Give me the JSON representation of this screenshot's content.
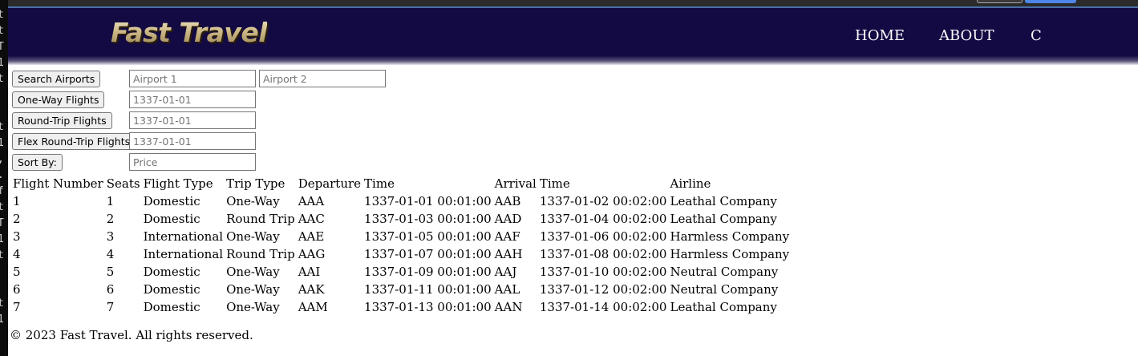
{
  "header": {
    "logo_text": "Fast Travel",
    "nav": [
      "HOME",
      "ABOUT",
      "C"
    ]
  },
  "controls": {
    "search_airports_label": "Search Airports",
    "airport1_placeholder": "Airport 1",
    "airport2_placeholder": "Airport 2",
    "one_way_label": "One-Way Flights",
    "one_way_placeholder": "1337-01-01",
    "round_trip_label": "Round-Trip Flights",
    "round_trip_placeholder": "1337-01-01",
    "flex_round_trip_label": "Flex Round-Trip Flights",
    "flex_round_trip_placeholder": "1337-01-01",
    "sort_by_label": "Sort By:",
    "sort_by_placeholder": "Price"
  },
  "table": {
    "headers": [
      "Flight Number",
      "Seats",
      "Flight Type",
      "Trip Type",
      "Departure",
      "Time",
      "Arrival",
      "Time",
      "Airline"
    ],
    "rows": [
      [
        "1",
        "1",
        "Domestic",
        "One-Way",
        "AAA",
        "1337-01-01 00:01:00",
        "AAB",
        "1337-01-02 00:02:00",
        "Leathal Company"
      ],
      [
        "2",
        "2",
        "Domestic",
        "Round Trip",
        "AAC",
        "1337-01-03 00:01:00",
        "AAD",
        "1337-01-04 00:02:00",
        "Leathal Company"
      ],
      [
        "3",
        "3",
        "International",
        "One-Way",
        "AAE",
        "1337-01-05 00:01:00",
        "AAF",
        "1337-01-06 00:02:00",
        "Harmless Company"
      ],
      [
        "4",
        "4",
        "International",
        "Round Trip",
        "AAG",
        "1337-01-07 00:01:00",
        "AAH",
        "1337-01-08 00:02:00",
        "Harmless Company"
      ],
      [
        "5",
        "5",
        "Domestic",
        "One-Way",
        "AAI",
        "1337-01-09 00:01:00",
        "AAJ",
        "1337-01-10 00:02:00",
        "Neutral Company"
      ],
      [
        "6",
        "6",
        "Domestic",
        "One-Way",
        "AAK",
        "1337-01-11 00:01:00",
        "AAL",
        "1337-01-12 00:02:00",
        "Neutral Company"
      ],
      [
        "7",
        "7",
        "Domestic",
        "One-Way",
        "AAM",
        "1337-01-13 00:01:00",
        "AAN",
        "1337-01-14 00:02:00",
        "Leathal Company"
      ]
    ]
  },
  "footer": {
    "text": "© 2023 Fast Travel. All rights reserved."
  },
  "left_strip_chars": [
    "t",
    "t",
    "T",
    "1",
    "t",
    "",
    "",
    "t",
    "1",
    ",",
    ".",
    "f",
    "t",
    "T",
    "1",
    "t",
    "",
    "",
    "t",
    "1"
  ],
  "colors": {
    "header_bg": "#130a43",
    "nav_text": "#ffffff",
    "logo_gold": "#cdbd92"
  }
}
